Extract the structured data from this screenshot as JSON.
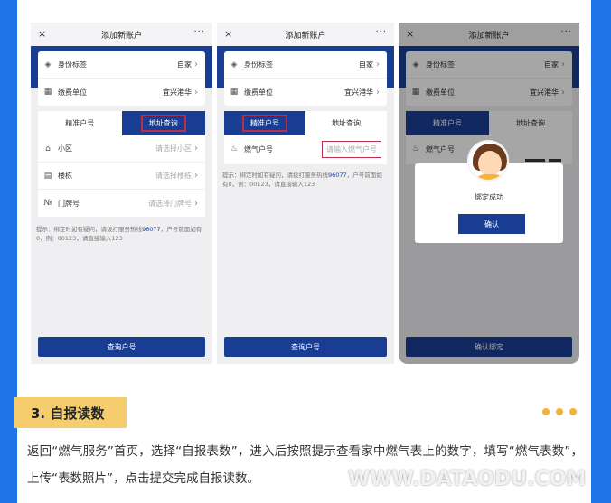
{
  "screens": [
    {
      "title": "添加新账户",
      "close_icon": "×",
      "more_icon": "···",
      "account": {
        "identity_label": "身份标签",
        "identity_value": "自家",
        "unit_label": "缴费单位",
        "unit_value": "宜兴港华"
      },
      "tabs": {
        "exact": "精准户号",
        "address": "地址查询"
      },
      "fields": [
        {
          "label": "小区",
          "placeholder": "请选择小区"
        },
        {
          "label": "楼栋",
          "placeholder": "请选择楼栋"
        },
        {
          "label": "门牌号",
          "placeholder": "请选择门牌号"
        }
      ],
      "hint_pre": "提示：绑定时如有疑问，请拨打服务热线",
      "hotline": "96077",
      "hint_post": "，户号前面如有0，例：00123，请直接输入123",
      "button": "查询户号"
    },
    {
      "title": "添加新账户",
      "close_icon": "×",
      "more_icon": "···",
      "account": {
        "identity_label": "身份标签",
        "identity_value": "自家",
        "unit_label": "缴费单位",
        "unit_value": "宜兴港华"
      },
      "tabs": {
        "exact": "精准户号",
        "address": "地址查询"
      },
      "gas_label": "燃气户号",
      "gas_placeholder": "请输入燃气户号",
      "hint_pre": "提示：绑定时如有疑问，请拨打服务热线",
      "hotline": "96077",
      "hint_post": "，户号前面如有0，例：00123，请直接输入123",
      "button": "查询户号"
    },
    {
      "title": "添加新账户",
      "close_icon": "×",
      "more_icon": "···",
      "account": {
        "identity_label": "身份标签",
        "identity_value": "自家",
        "unit_label": "缴费单位",
        "unit_value": "宜兴港华"
      },
      "tabs": {
        "exact": "精准户号",
        "address": "地址查询"
      },
      "gas_label": "燃气户号",
      "modal_message": "绑定成功",
      "modal_ok": "确认",
      "button": "确认绑定"
    }
  ],
  "section": {
    "title": "3. 自报读数"
  },
  "paragraph": "返回“燃气服务”首页，选择“自报表数”，进入后按照提示查看家中燃气表上的数字，填写“燃气表数”，上传“表数照片”，点击提交完成自报读数。",
  "watermark": "WWW.DATAODU.COM",
  "colors": {
    "brand_blue": "#1a3d94",
    "accent_yellow": "#f6cd6c",
    "highlight_red": "#b8304a",
    "edge_blue": "#1f74e8"
  }
}
